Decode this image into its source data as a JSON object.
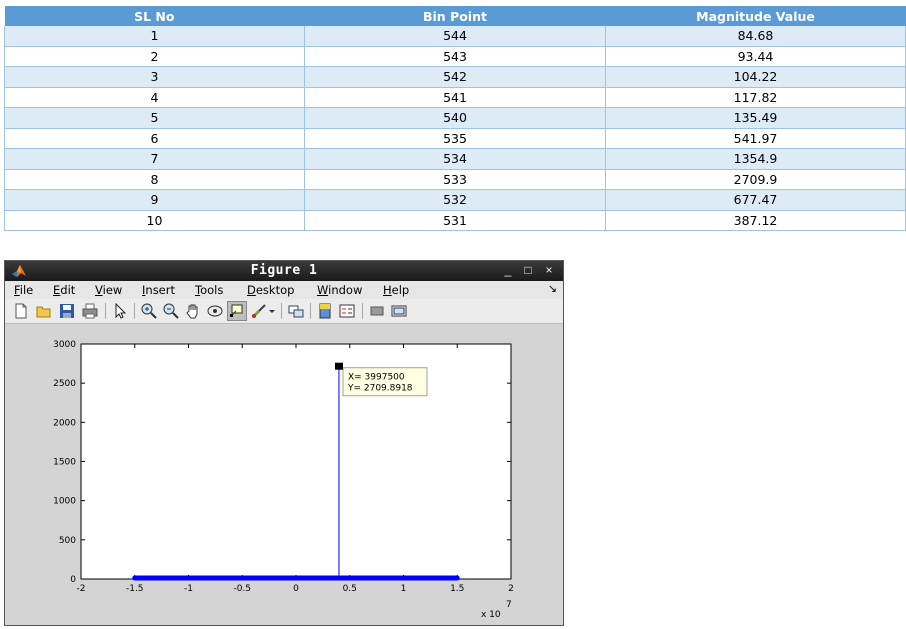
{
  "table": {
    "headers": [
      "SL No",
      "Bin Point",
      "Magnitude Value"
    ],
    "rows": [
      [
        "1",
        "544",
        "84.68"
      ],
      [
        "2",
        "543",
        "93.44"
      ],
      [
        "3",
        "542",
        "104.22"
      ],
      [
        "4",
        "541",
        "117.82"
      ],
      [
        "5",
        "540",
        "135.49"
      ],
      [
        "6",
        "535",
        "541.97"
      ],
      [
        "7",
        "534",
        "1354.9"
      ],
      [
        "8",
        "533",
        "2709.9"
      ],
      [
        "9",
        "532",
        "677.47"
      ],
      [
        "10",
        "531",
        "387.12"
      ]
    ]
  },
  "window": {
    "title": "Figure 1",
    "minimize_glyph": "_",
    "maximize_glyph": "□",
    "close_glyph": "×"
  },
  "menu": {
    "items": [
      {
        "key": "F",
        "rest": "ile"
      },
      {
        "key": "E",
        "rest": "dit"
      },
      {
        "key": "V",
        "rest": "iew"
      },
      {
        "key": "I",
        "rest": "nsert"
      },
      {
        "key": "T",
        "rest": "ools"
      },
      {
        "key": "D",
        "rest": "esktop"
      },
      {
        "key": "W",
        "rest": "indow"
      },
      {
        "key": "H",
        "rest": "elp"
      }
    ],
    "dock_glyph": "↘"
  },
  "toolbar": {
    "icons": [
      "new-figure-icon",
      "open-file-icon",
      "save-icon",
      "print-icon",
      "edit-plot-arrow-icon",
      "zoom-in-icon",
      "zoom-out-icon",
      "pan-hand-icon",
      "rotate-3d-icon",
      "data-cursor-icon",
      "brush-icon",
      "brush-dropdown-icon",
      "link-plot-icon",
      "insert-colorbar-icon",
      "insert-legend-icon",
      "hide-plot-tools-icon",
      "show-plot-tools-icon"
    ]
  },
  "chart_data": {
    "type": "line",
    "xlim": [
      -2,
      2
    ],
    "ylim": [
      0,
      3000
    ],
    "x_ticks": [
      "-2",
      "-1.5",
      "-1",
      "-0.5",
      "0",
      "0.5",
      "1",
      "1.5",
      "2"
    ],
    "y_ticks": [
      "0",
      "500",
      "1000",
      "1500",
      "2000",
      "2500",
      "3000"
    ],
    "x_exponent_label": "x 10",
    "x_exponent_power": "7",
    "baseline_range_x1e7": [
      -1.5,
      1.5
    ],
    "baseline_y": 0,
    "peak": {
      "x": 3997500,
      "y": 2709.8918
    },
    "line_color": "#0000ff",
    "datatip": {
      "x_text": "X= 3997500",
      "y_text": "Y= 2709.8918"
    },
    "grid": false
  }
}
